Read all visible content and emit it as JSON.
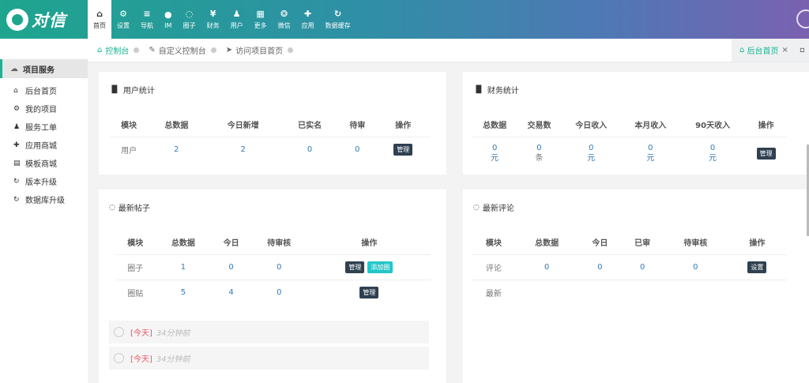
{
  "brand": {
    "logo_text": "对信",
    "colors": {
      "accent": "#1ab394",
      "topbar_start": "#1ea58e",
      "topbar_end": "#7a61b0",
      "badge": "#2f4050",
      "link": "#337ab7"
    }
  },
  "nav": [
    {
      "icon": "home-icon",
      "glyph": "⌂",
      "label": "首页",
      "active": true
    },
    {
      "icon": "gears-icon",
      "glyph": "⚙",
      "label": "设置"
    },
    {
      "icon": "menu-icon",
      "glyph": "≡",
      "label": "导航"
    },
    {
      "icon": "chat-icon",
      "glyph": "●",
      "label": "IM"
    },
    {
      "icon": "comments-icon",
      "glyph": "◌",
      "label": "圈子"
    },
    {
      "icon": "yen-icon",
      "glyph": "¥",
      "label": "财务"
    },
    {
      "icon": "user-icon",
      "glyph": "♟",
      "label": "用户"
    },
    {
      "icon": "grid-icon",
      "glyph": "▦",
      "label": "更多"
    },
    {
      "icon": "wechat-icon",
      "glyph": "❂",
      "label": "微信"
    },
    {
      "icon": "puzzle-icon",
      "glyph": "✚",
      "label": "应用"
    },
    {
      "icon": "refresh-icon",
      "glyph": "↻",
      "label": "数据缓存"
    }
  ],
  "sidebar": {
    "header": "项目服务",
    "items": [
      {
        "icon": "home-icon",
        "glyph": "⌂",
        "label": "后台首页"
      },
      {
        "icon": "gear-icon",
        "glyph": "⚙",
        "label": "我的项目"
      },
      {
        "icon": "user-tie-icon",
        "glyph": "♟",
        "label": "服务工单"
      },
      {
        "icon": "puzzle-icon",
        "glyph": "✚",
        "label": "应用商城"
      },
      {
        "icon": "template-icon",
        "glyph": "▤",
        "label": "模板商城"
      },
      {
        "icon": "refresh-icon",
        "glyph": "↻",
        "label": "版本升级"
      },
      {
        "icon": "refresh-icon",
        "glyph": "↻",
        "label": "数据库升级"
      }
    ]
  },
  "breadcrumbs": [
    {
      "icon": "home-icon",
      "glyph": "⌂",
      "label": "控制台"
    },
    {
      "icon": "edit-icon",
      "glyph": "✎",
      "label": "自定义控制台"
    },
    {
      "icon": "send-icon",
      "glyph": "➤",
      "label": "访问项目首页"
    }
  ],
  "tabs": {
    "active_label": "后台首页",
    "close": "×",
    "more": "▫"
  },
  "user_stats": {
    "title": "用户统计",
    "headers": [
      "模块",
      "总数据",
      "今日新增",
      "已实名",
      "待审",
      "操作"
    ],
    "row": {
      "module": "用户",
      "total": "2",
      "today": "2",
      "verified": "0",
      "pending": "0",
      "action": "管理"
    }
  },
  "finance_stats": {
    "title": "财务统计",
    "headers": [
      "总数据",
      "交易数",
      "今日收入",
      "本月收入",
      "90天收入",
      "操作"
    ],
    "values": [
      {
        "num": "0",
        "unit": "元"
      },
      {
        "num": "0",
        "unit": "条"
      },
      {
        "num": "0",
        "unit": "元"
      },
      {
        "num": "0",
        "unit": "元"
      },
      {
        "num": "0",
        "unit": "元"
      }
    ],
    "action": "管理"
  },
  "posts": {
    "title": "最新帖子",
    "headers": [
      "模块",
      "总数据",
      "今日",
      "待审核",
      "操作"
    ],
    "rows": [
      {
        "module": "圈子",
        "total": "1",
        "today": "0",
        "pending": "0",
        "action": "管理",
        "extra": "添加圈"
      },
      {
        "module": "圈贴",
        "total": "5",
        "today": "4",
        "pending": "0",
        "action": "管理"
      }
    ],
    "feed": [
      {
        "tag": "[今天]",
        "time": "34分钟前"
      },
      {
        "tag": "[今天]",
        "time": "34分钟前"
      }
    ]
  },
  "comments": {
    "title": "最新评论",
    "headers": [
      "模块",
      "总数据",
      "今日",
      "已审",
      "待审核",
      "操作"
    ],
    "rows": [
      {
        "module": "评论",
        "total": "0",
        "today": "0",
        "reviewed": "0",
        "pending": "0",
        "action": "设置"
      },
      {
        "module": "最新"
      }
    ]
  }
}
